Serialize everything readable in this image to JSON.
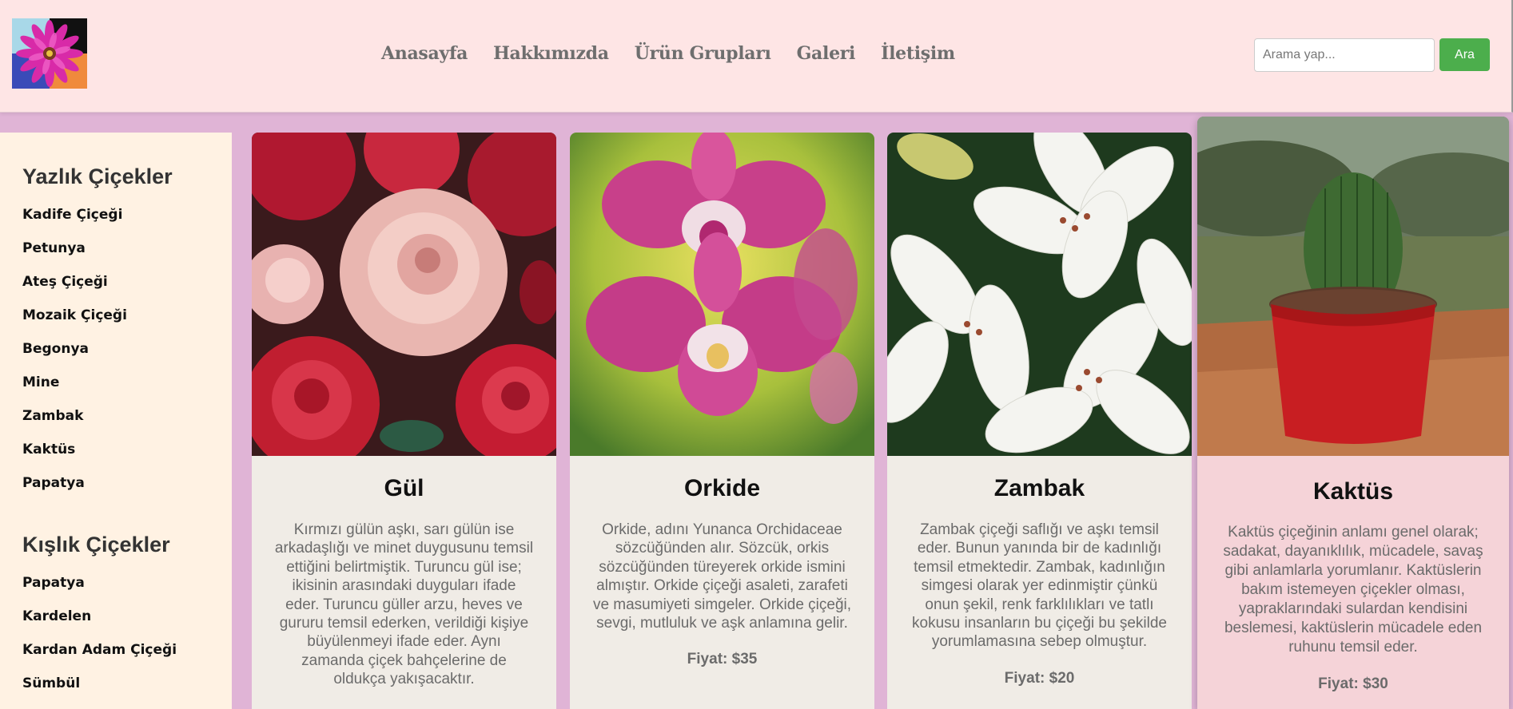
{
  "header": {
    "logo_name": "flower-logo",
    "nav": [
      "Anasayfa",
      "Hakkımızda",
      "Ürün Grupları",
      "Galeri",
      "İletişim"
    ],
    "search": {
      "placeholder": "Arama yap...",
      "value": "",
      "button_label": "Ara"
    }
  },
  "sidebar": {
    "summer_title": "Yazlık Çiçekler",
    "summer_items": [
      "Kadife Çiçeği",
      "Petunya",
      "Ateş Çiçeği",
      "Mozaik Çiçeği",
      "Begonya",
      "Mine",
      "Zambak",
      "Kaktüs",
      "Papatya"
    ],
    "winter_title": "Kışlık Çiçekler",
    "winter_items": [
      "Papatya",
      "Kardelen",
      "Kardan Adam Çiçeği",
      "Sümbül"
    ]
  },
  "cards": [
    {
      "name": "Gül",
      "image": "red-pink-roses",
      "description": "Kırmızı gülün aşkı, sarı gülün ise arkadaşlığı ve minet duygusunu temsil ettiğini belirtmiştik. Turuncu gül ise; ikisinin arasındaki duyguları ifade eder. Turuncu güller arzu, heves ve gururu temsil ederken, verildiği kişiye büyülenmeyi ifade eder. Aynı zamanda çiçek bahçelerine de oldukça yakışacaktır.",
      "price": ""
    },
    {
      "name": "Orkide",
      "image": "pink-orchids",
      "description": "Orkide, adını Yunanca Orchidaceae sözcüğünden alır. Sözcük, orkis sözcüğünden türeyerek orkide ismini almıştır. Orkide çiçeği asaleti, zarafeti ve masumiyeti simgeler. Orkide çiçeği, sevgi, mutluluk ve aşk anlamına gelir.",
      "price": "Fiyat: $35"
    },
    {
      "name": "Zambak",
      "image": "white-lilies",
      "description": "Zambak çiçeği saflığı ve aşkı temsil eder. Bunun yanında bir de kadınlığı temsil etmektedir. Zambak, kadınlığın simgesi olarak yer edinmiştir çünkü onun şekil, renk farklılıkları ve tatlı kokusu insanların bu çiçeği bu şekilde yorumlamasına sebep olmuştur.",
      "price": "Fiyat: $20"
    },
    {
      "name": "Kaktüs",
      "image": "potted-cactus",
      "description": "Kaktüs çiçeğinin anlamı genel olarak; sadakat, dayanıklılık, mücadele, savaş gibi anlamlarla yorumlanır. Kaktüslerin bakım istemeyen çiçekler olması, yapraklarındaki sulardan kendisini beslemesi, kaktüslerin mücadele eden ruhunu temsil eder.",
      "price": "Fiyat: $30"
    }
  ]
}
